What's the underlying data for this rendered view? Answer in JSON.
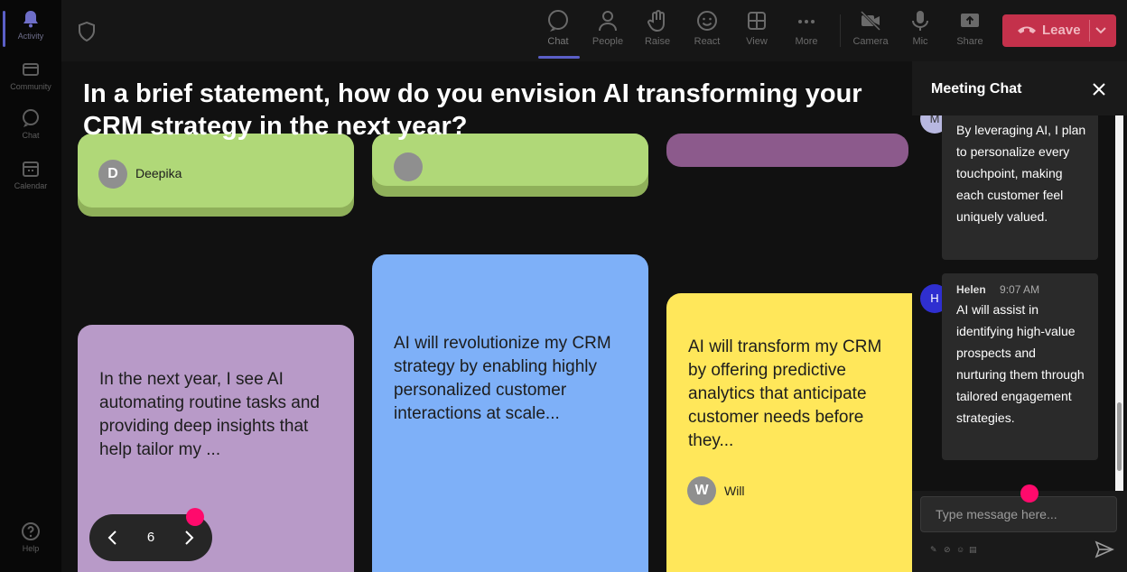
{
  "rail": {
    "items": [
      {
        "label": "Activity",
        "icon": "bell-icon"
      },
      {
        "label": "Community",
        "icon": "community-icon"
      },
      {
        "label": "Chat",
        "icon": "chat-icon"
      },
      {
        "label": "Calendar",
        "icon": "calendar-icon"
      }
    ],
    "help_label": "Help"
  },
  "toolbar": {
    "chat": "Chat",
    "people": "People",
    "raise": "Raise",
    "react": "React",
    "view": "View",
    "more": "More",
    "camera": "Camera",
    "mic": "Mic",
    "share": "Share",
    "leave": "Leave"
  },
  "stage": {
    "question": "In a brief statement, how do you envision AI transforming your CRM strategy in the next year?",
    "cards": [
      {
        "author": "Deepika",
        "initial": "D",
        "color": "#b0d878"
      },
      {
        "author": "",
        "initial": "",
        "color": "#b0d878"
      },
      {
        "author": "",
        "initial": "",
        "color": "#8c5a8c"
      },
      {
        "text": "In the next year, I see AI automating routine tasks and providing deep insights that help tailor my ...",
        "color": "#b89ac8"
      },
      {
        "text": "AI will revolutionize my CRM strategy by enabling highly personalized customer interactions at scale...",
        "color": "#7eb0f8"
      },
      {
        "text": "AI will transform my CRM by offering predictive analytics that anticipate customer needs before they...",
        "author": "Will",
        "initial": "W",
        "color": "#ffe75a"
      }
    ],
    "page_number": "6"
  },
  "chat": {
    "title": "Meeting Chat",
    "messages": [
      {
        "initial": "M",
        "text": "By leveraging AI, I plan to personalize every touchpoint, making each customer feel uniquely valued."
      },
      {
        "initial": "H",
        "name": "Helen",
        "time": "9:07 AM",
        "text": "AI will assist in identifying high-value prospects and nurturing them through tailored engagement strategies."
      }
    ],
    "input_placeholder": "Type message here..."
  },
  "colors": {
    "accent": "#5b5fc7",
    "leave": "#c4314b",
    "marker": "#ff0a6c"
  }
}
